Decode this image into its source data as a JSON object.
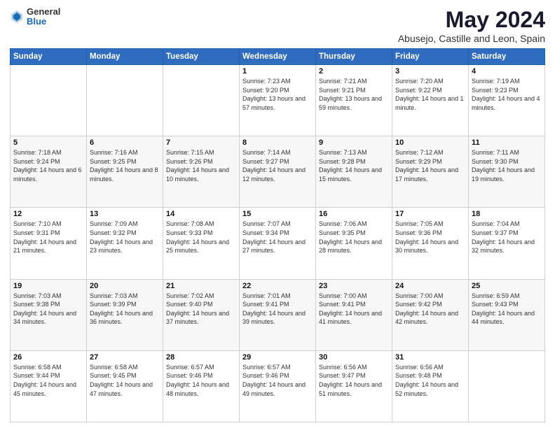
{
  "logo": {
    "general": "General",
    "blue": "Blue"
  },
  "header": {
    "title": "May 2024",
    "subtitle": "Abusejo, Castille and Leon, Spain"
  },
  "weekdays": [
    "Sunday",
    "Monday",
    "Tuesday",
    "Wednesday",
    "Thursday",
    "Friday",
    "Saturday"
  ],
  "weeks": [
    [
      {
        "day": "",
        "sunrise": "",
        "sunset": "",
        "daylight": ""
      },
      {
        "day": "",
        "sunrise": "",
        "sunset": "",
        "daylight": ""
      },
      {
        "day": "",
        "sunrise": "",
        "sunset": "",
        "daylight": ""
      },
      {
        "day": "1",
        "sunrise": "Sunrise: 7:23 AM",
        "sunset": "Sunset: 9:20 PM",
        "daylight": "Daylight: 13 hours and 57 minutes."
      },
      {
        "day": "2",
        "sunrise": "Sunrise: 7:21 AM",
        "sunset": "Sunset: 9:21 PM",
        "daylight": "Daylight: 13 hours and 59 minutes."
      },
      {
        "day": "3",
        "sunrise": "Sunrise: 7:20 AM",
        "sunset": "Sunset: 9:22 PM",
        "daylight": "Daylight: 14 hours and 1 minute."
      },
      {
        "day": "4",
        "sunrise": "Sunrise: 7:19 AM",
        "sunset": "Sunset: 9:23 PM",
        "daylight": "Daylight: 14 hours and 4 minutes."
      }
    ],
    [
      {
        "day": "5",
        "sunrise": "Sunrise: 7:18 AM",
        "sunset": "Sunset: 9:24 PM",
        "daylight": "Daylight: 14 hours and 6 minutes."
      },
      {
        "day": "6",
        "sunrise": "Sunrise: 7:16 AM",
        "sunset": "Sunset: 9:25 PM",
        "daylight": "Daylight: 14 hours and 8 minutes."
      },
      {
        "day": "7",
        "sunrise": "Sunrise: 7:15 AM",
        "sunset": "Sunset: 9:26 PM",
        "daylight": "Daylight: 14 hours and 10 minutes."
      },
      {
        "day": "8",
        "sunrise": "Sunrise: 7:14 AM",
        "sunset": "Sunset: 9:27 PM",
        "daylight": "Daylight: 14 hours and 12 minutes."
      },
      {
        "day": "9",
        "sunrise": "Sunrise: 7:13 AM",
        "sunset": "Sunset: 9:28 PM",
        "daylight": "Daylight: 14 hours and 15 minutes."
      },
      {
        "day": "10",
        "sunrise": "Sunrise: 7:12 AM",
        "sunset": "Sunset: 9:29 PM",
        "daylight": "Daylight: 14 hours and 17 minutes."
      },
      {
        "day": "11",
        "sunrise": "Sunrise: 7:11 AM",
        "sunset": "Sunset: 9:30 PM",
        "daylight": "Daylight: 14 hours and 19 minutes."
      }
    ],
    [
      {
        "day": "12",
        "sunrise": "Sunrise: 7:10 AM",
        "sunset": "Sunset: 9:31 PM",
        "daylight": "Daylight: 14 hours and 21 minutes."
      },
      {
        "day": "13",
        "sunrise": "Sunrise: 7:09 AM",
        "sunset": "Sunset: 9:32 PM",
        "daylight": "Daylight: 14 hours and 23 minutes."
      },
      {
        "day": "14",
        "sunrise": "Sunrise: 7:08 AM",
        "sunset": "Sunset: 9:33 PM",
        "daylight": "Daylight: 14 hours and 25 minutes."
      },
      {
        "day": "15",
        "sunrise": "Sunrise: 7:07 AM",
        "sunset": "Sunset: 9:34 PM",
        "daylight": "Daylight: 14 hours and 27 minutes."
      },
      {
        "day": "16",
        "sunrise": "Sunrise: 7:06 AM",
        "sunset": "Sunset: 9:35 PM",
        "daylight": "Daylight: 14 hours and 28 minutes."
      },
      {
        "day": "17",
        "sunrise": "Sunrise: 7:05 AM",
        "sunset": "Sunset: 9:36 PM",
        "daylight": "Daylight: 14 hours and 30 minutes."
      },
      {
        "day": "18",
        "sunrise": "Sunrise: 7:04 AM",
        "sunset": "Sunset: 9:37 PM",
        "daylight": "Daylight: 14 hours and 32 minutes."
      }
    ],
    [
      {
        "day": "19",
        "sunrise": "Sunrise: 7:03 AM",
        "sunset": "Sunset: 9:38 PM",
        "daylight": "Daylight: 14 hours and 34 minutes."
      },
      {
        "day": "20",
        "sunrise": "Sunrise: 7:03 AM",
        "sunset": "Sunset: 9:39 PM",
        "daylight": "Daylight: 14 hours and 36 minutes."
      },
      {
        "day": "21",
        "sunrise": "Sunrise: 7:02 AM",
        "sunset": "Sunset: 9:40 PM",
        "daylight": "Daylight: 14 hours and 37 minutes."
      },
      {
        "day": "22",
        "sunrise": "Sunrise: 7:01 AM",
        "sunset": "Sunset: 9:41 PM",
        "daylight": "Daylight: 14 hours and 39 minutes."
      },
      {
        "day": "23",
        "sunrise": "Sunrise: 7:00 AM",
        "sunset": "Sunset: 9:41 PM",
        "daylight": "Daylight: 14 hours and 41 minutes."
      },
      {
        "day": "24",
        "sunrise": "Sunrise: 7:00 AM",
        "sunset": "Sunset: 9:42 PM",
        "daylight": "Daylight: 14 hours and 42 minutes."
      },
      {
        "day": "25",
        "sunrise": "Sunrise: 6:59 AM",
        "sunset": "Sunset: 9:43 PM",
        "daylight": "Daylight: 14 hours and 44 minutes."
      }
    ],
    [
      {
        "day": "26",
        "sunrise": "Sunrise: 6:58 AM",
        "sunset": "Sunset: 9:44 PM",
        "daylight": "Daylight: 14 hours and 45 minutes."
      },
      {
        "day": "27",
        "sunrise": "Sunrise: 6:58 AM",
        "sunset": "Sunset: 9:45 PM",
        "daylight": "Daylight: 14 hours and 47 minutes."
      },
      {
        "day": "28",
        "sunrise": "Sunrise: 6:57 AM",
        "sunset": "Sunset: 9:46 PM",
        "daylight": "Daylight: 14 hours and 48 minutes."
      },
      {
        "day": "29",
        "sunrise": "Sunrise: 6:57 AM",
        "sunset": "Sunset: 9:46 PM",
        "daylight": "Daylight: 14 hours and 49 minutes."
      },
      {
        "day": "30",
        "sunrise": "Sunrise: 6:56 AM",
        "sunset": "Sunset: 9:47 PM",
        "daylight": "Daylight: 14 hours and 51 minutes."
      },
      {
        "day": "31",
        "sunrise": "Sunrise: 6:56 AM",
        "sunset": "Sunset: 9:48 PM",
        "daylight": "Daylight: 14 hours and 52 minutes."
      },
      {
        "day": "",
        "sunrise": "",
        "sunset": "",
        "daylight": ""
      }
    ]
  ]
}
